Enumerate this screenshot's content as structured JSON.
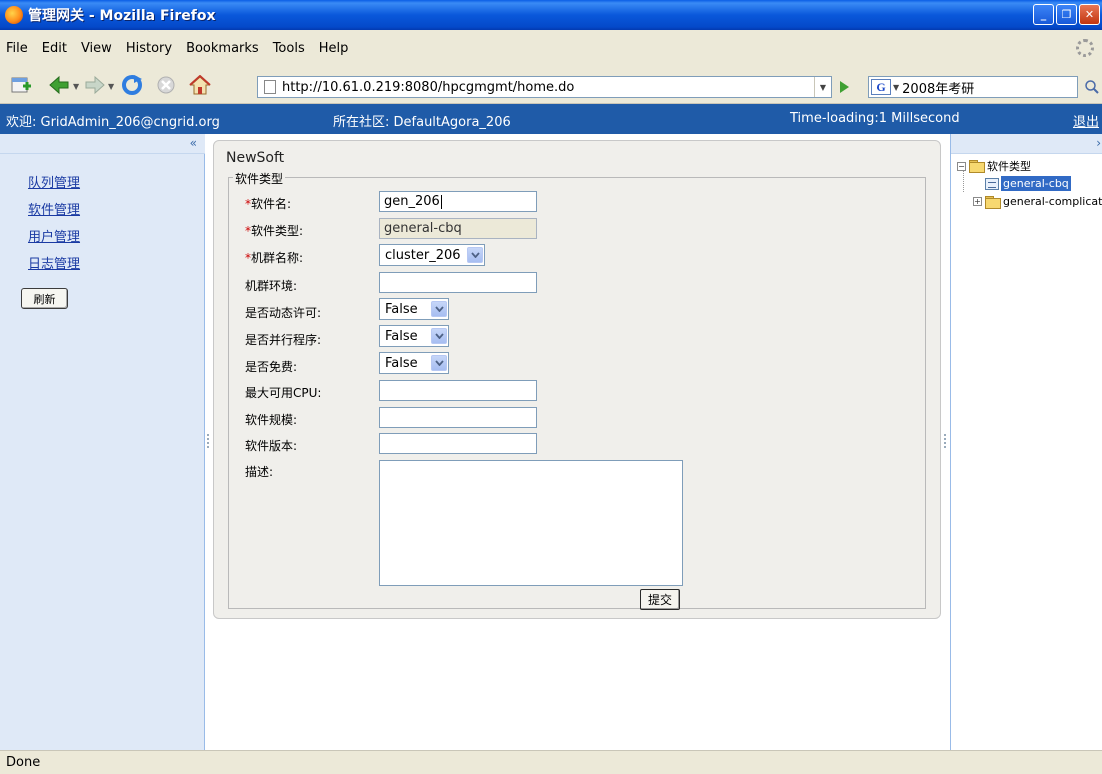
{
  "window": {
    "title": "管理网关 - Mozilla Firefox"
  },
  "menu": {
    "items": [
      "File",
      "Edit",
      "View",
      "History",
      "Bookmarks",
      "Tools",
      "Help"
    ]
  },
  "navbar": {
    "url": "http://10.61.0.219:8080/hpcgmgmt/home.do",
    "search_engine": "G",
    "search_value": "2008年考研"
  },
  "app_header": {
    "welcome": "欢迎: GridAdmin_206@cngrid.org",
    "community": "所在社区: DefaultAgora_206",
    "time_loading": "Time-loading:1 Millsecond",
    "logout": "退出"
  },
  "sidebar": {
    "collapse": "«",
    "items": [
      {
        "label": "队列管理"
      },
      {
        "label": "软件管理"
      },
      {
        "label": "用户管理"
      },
      {
        "label": "日志管理"
      }
    ],
    "refresh_label": "刷新"
  },
  "form": {
    "title": "NewSoft",
    "legend": "软件类型",
    "fields": [
      {
        "label": "软件名:",
        "required": true,
        "value": "gen_206"
      },
      {
        "label": "软件类型:",
        "required": true,
        "value": "general-cbq"
      },
      {
        "label": "机群名称:",
        "required": true,
        "value": "cluster_206"
      },
      {
        "label": "机群环境:",
        "required": false,
        "value": ""
      },
      {
        "label": "是否动态许可:",
        "required": false,
        "value": "False"
      },
      {
        "label": "是否并行程序:",
        "required": false,
        "value": "False"
      },
      {
        "label": "是否免费:",
        "required": false,
        "value": "False"
      },
      {
        "label": "最大可用CPU:",
        "required": false,
        "value": ""
      },
      {
        "label": "软件规模:",
        "required": false,
        "value": ""
      },
      {
        "label": "软件版本:",
        "required": false,
        "value": ""
      },
      {
        "label": "描述:",
        "required": false,
        "value": ""
      }
    ],
    "required_mark": "*",
    "submit_label": "提交"
  },
  "tree": {
    "collapse": "›",
    "root": {
      "label": "软件类型",
      "toggle": "−"
    },
    "children": [
      {
        "label": "general-cbq",
        "selected": true
      },
      {
        "label": "general-complicate",
        "toggle": "+"
      }
    ]
  },
  "status": {
    "text": "Done"
  },
  "colors": {
    "header_bg": "#1f5ba8",
    "panel_bg": "#dfe9f7",
    "required": "#cc0000",
    "tree_selected": "#316ac5"
  }
}
